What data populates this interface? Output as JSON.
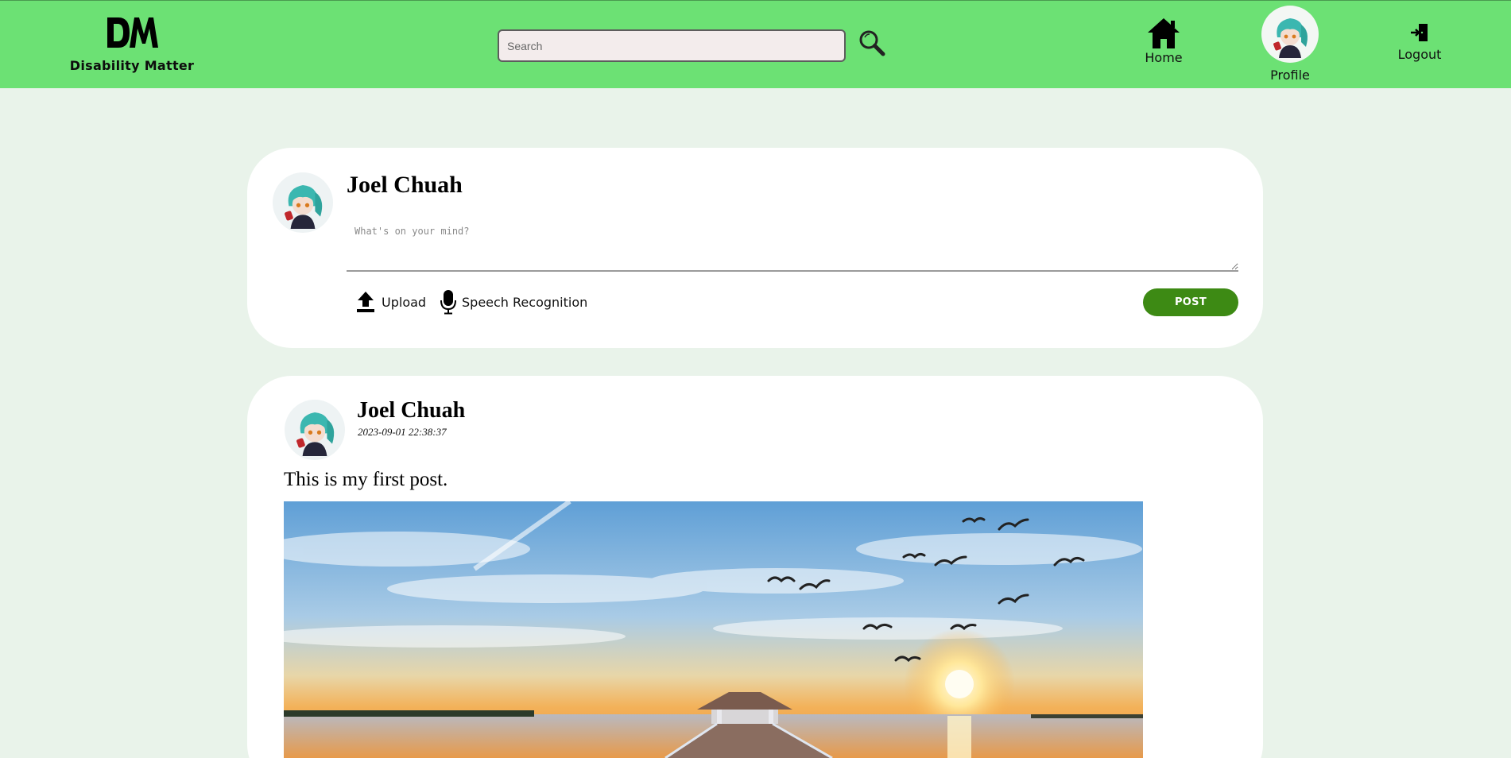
{
  "brand": {
    "name": "Disability Matter",
    "logo_letters": "DM"
  },
  "search": {
    "placeholder": "Search",
    "value": ""
  },
  "nav": {
    "home_label": "Home",
    "profile_label": "Profile",
    "logout_label": "Logout"
  },
  "icons": {
    "logo": "dm-logo-icon",
    "search": "magnifier-icon",
    "home": "house-icon",
    "logout": "door-exit-icon",
    "upload": "upload-arrow-icon",
    "speech": "microphone-icon"
  },
  "colors": {
    "header_bg": "#6ce174",
    "page_bg": "#e9f3ea",
    "post_button": "#3d8a14"
  },
  "composer": {
    "author": "Joel Chuah",
    "placeholder": "What's on your mind?",
    "upload_label": "Upload",
    "speech_label": "Speech Recognition",
    "post_label": "POST"
  },
  "post": {
    "author": "Joel Chuah",
    "timestamp": "2023-09-01 22:38:37",
    "body": "This is my first post."
  }
}
